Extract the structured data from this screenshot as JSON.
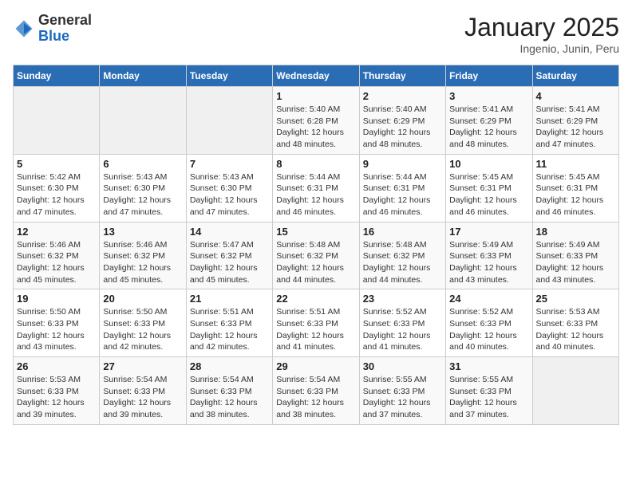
{
  "logo": {
    "general": "General",
    "blue": "Blue"
  },
  "title": "January 2025",
  "subtitle": "Ingenio, Junin, Peru",
  "weekdays": [
    "Sunday",
    "Monday",
    "Tuesday",
    "Wednesday",
    "Thursday",
    "Friday",
    "Saturday"
  ],
  "weeks": [
    [
      {
        "day": "",
        "info": ""
      },
      {
        "day": "",
        "info": ""
      },
      {
        "day": "",
        "info": ""
      },
      {
        "day": "1",
        "info": "Sunrise: 5:40 AM\nSunset: 6:28 PM\nDaylight: 12 hours\nand 48 minutes."
      },
      {
        "day": "2",
        "info": "Sunrise: 5:40 AM\nSunset: 6:29 PM\nDaylight: 12 hours\nand 48 minutes."
      },
      {
        "day": "3",
        "info": "Sunrise: 5:41 AM\nSunset: 6:29 PM\nDaylight: 12 hours\nand 48 minutes."
      },
      {
        "day": "4",
        "info": "Sunrise: 5:41 AM\nSunset: 6:29 PM\nDaylight: 12 hours\nand 47 minutes."
      }
    ],
    [
      {
        "day": "5",
        "info": "Sunrise: 5:42 AM\nSunset: 6:30 PM\nDaylight: 12 hours\nand 47 minutes."
      },
      {
        "day": "6",
        "info": "Sunrise: 5:43 AM\nSunset: 6:30 PM\nDaylight: 12 hours\nand 47 minutes."
      },
      {
        "day": "7",
        "info": "Sunrise: 5:43 AM\nSunset: 6:30 PM\nDaylight: 12 hours\nand 47 minutes."
      },
      {
        "day": "8",
        "info": "Sunrise: 5:44 AM\nSunset: 6:31 PM\nDaylight: 12 hours\nand 46 minutes."
      },
      {
        "day": "9",
        "info": "Sunrise: 5:44 AM\nSunset: 6:31 PM\nDaylight: 12 hours\nand 46 minutes."
      },
      {
        "day": "10",
        "info": "Sunrise: 5:45 AM\nSunset: 6:31 PM\nDaylight: 12 hours\nand 46 minutes."
      },
      {
        "day": "11",
        "info": "Sunrise: 5:45 AM\nSunset: 6:31 PM\nDaylight: 12 hours\nand 46 minutes."
      }
    ],
    [
      {
        "day": "12",
        "info": "Sunrise: 5:46 AM\nSunset: 6:32 PM\nDaylight: 12 hours\nand 45 minutes."
      },
      {
        "day": "13",
        "info": "Sunrise: 5:46 AM\nSunset: 6:32 PM\nDaylight: 12 hours\nand 45 minutes."
      },
      {
        "day": "14",
        "info": "Sunrise: 5:47 AM\nSunset: 6:32 PM\nDaylight: 12 hours\nand 45 minutes."
      },
      {
        "day": "15",
        "info": "Sunrise: 5:48 AM\nSunset: 6:32 PM\nDaylight: 12 hours\nand 44 minutes."
      },
      {
        "day": "16",
        "info": "Sunrise: 5:48 AM\nSunset: 6:32 PM\nDaylight: 12 hours\nand 44 minutes."
      },
      {
        "day": "17",
        "info": "Sunrise: 5:49 AM\nSunset: 6:33 PM\nDaylight: 12 hours\nand 43 minutes."
      },
      {
        "day": "18",
        "info": "Sunrise: 5:49 AM\nSunset: 6:33 PM\nDaylight: 12 hours\nand 43 minutes."
      }
    ],
    [
      {
        "day": "19",
        "info": "Sunrise: 5:50 AM\nSunset: 6:33 PM\nDaylight: 12 hours\nand 43 minutes."
      },
      {
        "day": "20",
        "info": "Sunrise: 5:50 AM\nSunset: 6:33 PM\nDaylight: 12 hours\nand 42 minutes."
      },
      {
        "day": "21",
        "info": "Sunrise: 5:51 AM\nSunset: 6:33 PM\nDaylight: 12 hours\nand 42 minutes."
      },
      {
        "day": "22",
        "info": "Sunrise: 5:51 AM\nSunset: 6:33 PM\nDaylight: 12 hours\nand 41 minutes."
      },
      {
        "day": "23",
        "info": "Sunrise: 5:52 AM\nSunset: 6:33 PM\nDaylight: 12 hours\nand 41 minutes."
      },
      {
        "day": "24",
        "info": "Sunrise: 5:52 AM\nSunset: 6:33 PM\nDaylight: 12 hours\nand 40 minutes."
      },
      {
        "day": "25",
        "info": "Sunrise: 5:53 AM\nSunset: 6:33 PM\nDaylight: 12 hours\nand 40 minutes."
      }
    ],
    [
      {
        "day": "26",
        "info": "Sunrise: 5:53 AM\nSunset: 6:33 PM\nDaylight: 12 hours\nand 39 minutes."
      },
      {
        "day": "27",
        "info": "Sunrise: 5:54 AM\nSunset: 6:33 PM\nDaylight: 12 hours\nand 39 minutes."
      },
      {
        "day": "28",
        "info": "Sunrise: 5:54 AM\nSunset: 6:33 PM\nDaylight: 12 hours\nand 38 minutes."
      },
      {
        "day": "29",
        "info": "Sunrise: 5:54 AM\nSunset: 6:33 PM\nDaylight: 12 hours\nand 38 minutes."
      },
      {
        "day": "30",
        "info": "Sunrise: 5:55 AM\nSunset: 6:33 PM\nDaylight: 12 hours\nand 37 minutes."
      },
      {
        "day": "31",
        "info": "Sunrise: 5:55 AM\nSunset: 6:33 PM\nDaylight: 12 hours\nand 37 minutes."
      },
      {
        "day": "",
        "info": ""
      }
    ]
  ]
}
